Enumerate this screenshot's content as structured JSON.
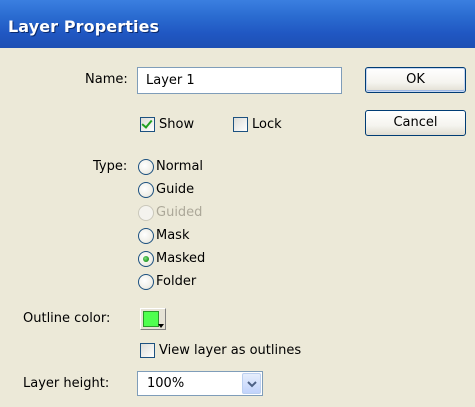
{
  "window": {
    "title": "Layer Properties"
  },
  "form": {
    "name_label": "Name:",
    "name_value": "Layer 1",
    "show_label": "Show",
    "show_checked": true,
    "lock_label": "Lock",
    "lock_checked": false,
    "type_label": "Type:",
    "types": [
      {
        "label": "Normal",
        "selected": false,
        "disabled": false
      },
      {
        "label": "Guide",
        "selected": false,
        "disabled": false
      },
      {
        "label": "Guided",
        "selected": false,
        "disabled": true
      },
      {
        "label": "Mask",
        "selected": false,
        "disabled": false
      },
      {
        "label": "Masked",
        "selected": true,
        "disabled": false
      },
      {
        "label": "Folder",
        "selected": false,
        "disabled": false
      }
    ],
    "outline_color_label": "Outline color:",
    "outline_color": "#4fff4f",
    "view_outlines_label": "View layer as outlines",
    "view_outlines_checked": false,
    "layer_height_label": "Layer height:",
    "layer_height_value": "100%"
  },
  "buttons": {
    "ok": "OK",
    "cancel": "Cancel"
  },
  "icons": {
    "dropdown": "chevron-down-icon",
    "color_picker": "color-swatch-icon"
  }
}
